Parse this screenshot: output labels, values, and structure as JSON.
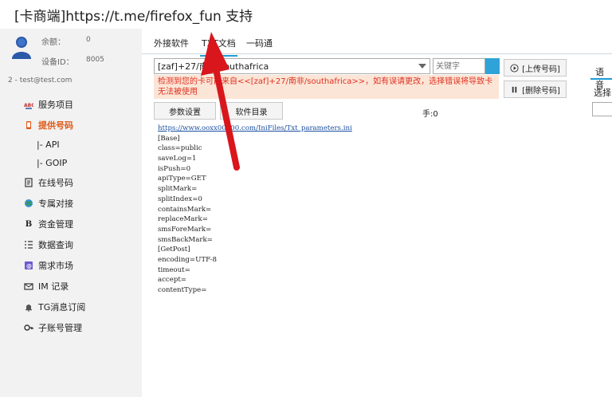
{
  "title": "[卡商端]https://t.me/firefox_fun 支持",
  "sidebar": {
    "balance_label": "余额：",
    "balance_value": "0",
    "device_label": "设备ID：",
    "device_value": "8005",
    "account": "2 - test@test.com",
    "items": [
      {
        "label": "服务项目",
        "icon": "abc-icon"
      },
      {
        "label": "提供号码",
        "icon": "phone-icon",
        "active": true
      },
      {
        "label": "|-  API",
        "sub": true
      },
      {
        "label": "|-  GOIP",
        "sub": true
      },
      {
        "label": "在线号码",
        "icon": "document-icon"
      },
      {
        "label": "专属对接",
        "icon": "globe-icon"
      },
      {
        "label": "资金管理",
        "icon": "b-icon"
      },
      {
        "label": "数据查询",
        "icon": "list-icon"
      },
      {
        "label": "需求市场",
        "icon": "market-icon"
      },
      {
        "label": "IM 记录",
        "icon": "mail-icon"
      },
      {
        "label": "TG消息订阅",
        "icon": "bell-icon"
      },
      {
        "label": "子账号管理",
        "icon": "key-icon"
      }
    ]
  },
  "tabs": [
    {
      "label": "外接软件"
    },
    {
      "label": "TXT文档",
      "active": true
    },
    {
      "label": "一码通"
    }
  ],
  "toolbar": {
    "country_value": "[zaf]+27/南非/southafrica",
    "keyword_placeholder": "关键字",
    "upload_label": "[上传号码]",
    "delete_label": "[删除号码]",
    "params_label": "参数设置",
    "software_dir_label": "软件目录",
    "hand_label": "手:0"
  },
  "warning": "检测到您的卡可能来自<<[zaf]+27/南非/southafrica>>，如有误请更改，选择错误将导致卡无法被使用",
  "right_panel": {
    "tab_label": "语音",
    "select_label": "选择"
  },
  "document": {
    "link": "https://www.ooxx00000.com/IniFiles/Txt_parameters.ini",
    "lines": [
      "[Base]",
      "class=public",
      "saveLog=1",
      "isPush=0",
      "apiType=GET",
      "splitMark=",
      "splitIndex=0",
      "containsMark=",
      "replaceMark=",
      "smsForeMark=",
      "smsBackMark=",
      "[GetPost]",
      "encoding=UTF-8",
      "timeout=",
      "accept=",
      "contentType="
    ]
  },
  "colors": {
    "accent": "#1f9bd7",
    "active_nav": "#e05a1a",
    "warning_bg": "#fbe5d6",
    "warning_text": "#e03020",
    "arrow": "#d9161c"
  }
}
